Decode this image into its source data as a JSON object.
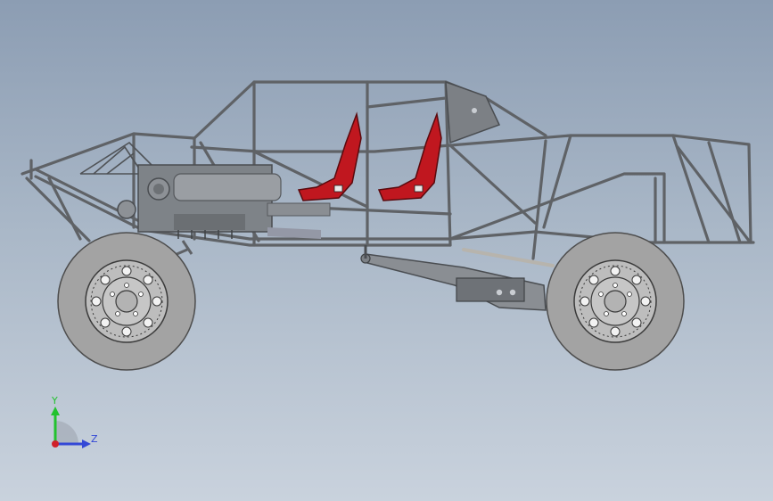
{
  "viewport": {
    "background_top": "#8c9db3",
    "background_bottom": "#c9d2dd"
  },
  "model": {
    "frame_color": "#5f6266",
    "seat_color": "#c0171f",
    "tire_color": "#a3a3a3",
    "rim_color": "#bdbdbd"
  },
  "triad": {
    "y_label": "Y",
    "z_label": "Z",
    "y_color": "#22c22e",
    "z_color": "#3348d6",
    "x_color": "#d0202a"
  }
}
